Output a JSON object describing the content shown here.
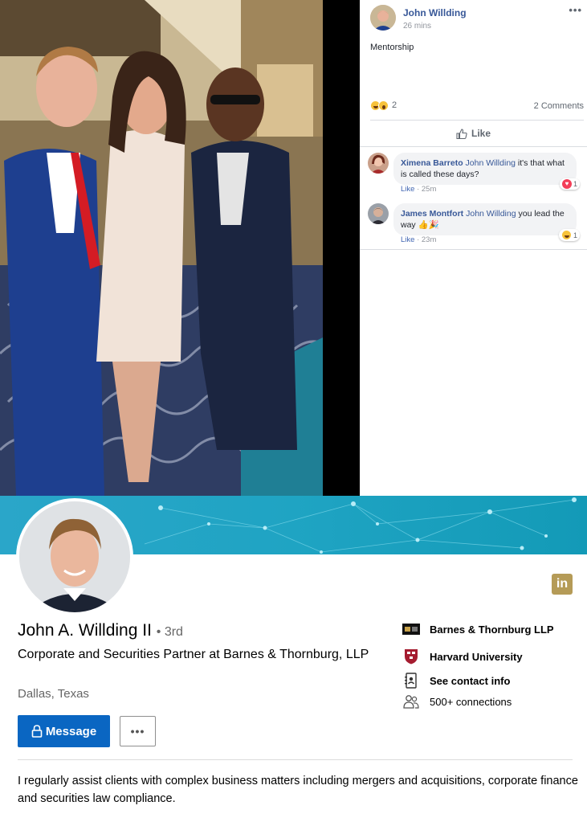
{
  "facebook_post": {
    "author": "John Willding",
    "time": "26 mins",
    "text": "Mentorship",
    "reaction_icons": [
      "laugh-emoji",
      "wow-emoji"
    ],
    "reaction_count": "2",
    "comments_count": "2 Comments",
    "like_label": "Like",
    "comments": [
      {
        "name": "Ximena Barreto",
        "tag": "John Willding",
        "text": "it's that what is called these days?",
        "like_label": "Like",
        "time": "25m",
        "reaction_icon": "heart-icon",
        "reaction_count": "1"
      },
      {
        "name": "James Montfort",
        "tag": "John Willding",
        "text": "you lead the way 👍🎉",
        "like_label": "Like",
        "time": "23m",
        "reaction_icon": "laugh-emoji",
        "reaction_count": "1"
      }
    ]
  },
  "linkedin_profile": {
    "logo": "in",
    "name": "John A. Willding II",
    "degree": "3rd",
    "headline": "Corporate and Securities Partner at Barnes & Thornburg, LLP",
    "location": "Dallas, Texas",
    "message_label": "Message",
    "more_label": "•••",
    "side_items": [
      {
        "icon": "company-logo-icon",
        "label": "Barnes & Thornburg LLP"
      },
      {
        "icon": "harvard-shield-icon",
        "label": "Harvard University"
      },
      {
        "icon": "contact-card-icon",
        "label": "See contact info"
      },
      {
        "icon": "connections-icon",
        "label": "500+ connections"
      }
    ],
    "summary": "I regularly assist clients with complex business matters including mergers and acquisitions, corporate finance and securities law compliance."
  },
  "colors": {
    "facebook_link": "#385898",
    "linkedin_blue": "#0a66c2",
    "banner_teal": "#1fa4c3",
    "linkedin_gold": "#b59b57"
  }
}
